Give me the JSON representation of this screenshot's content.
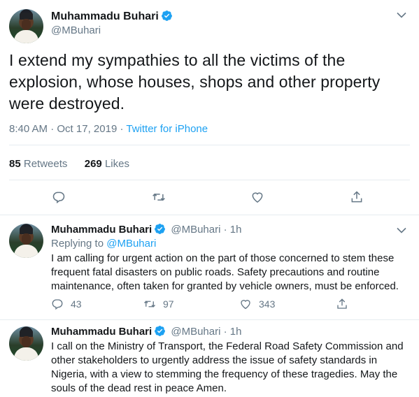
{
  "main_tweet": {
    "author_name": "Muhammadu Buhari",
    "author_handle": "@MBuhari",
    "text": "I extend my sympathies to all the victims of the explosion, whose houses, shops and other property were destroyed.",
    "time": "8:40 AM",
    "date": "Oct 17, 2019",
    "separator": "·",
    "client": "Twitter for iPhone",
    "retweets_count": "85",
    "retweets_label": "Retweets",
    "likes_count": "269",
    "likes_label": "Likes"
  },
  "replies": [
    {
      "author_name": "Muhammadu Buhari",
      "author_handle": "@MBuhari",
      "time_ago": "· 1h",
      "replying_label": "Replying to",
      "replying_to": "@MBuhari",
      "text": "I am calling for urgent action on the part of those concerned to stem these frequent fatal disasters on public roads. Safety precautions and routine maintenance, often taken for granted by vehicle owners, must be enforced.",
      "reply_count": "43",
      "retweet_count": "97",
      "like_count": "343"
    },
    {
      "author_name": "Muhammadu Buhari",
      "author_handle": "@MBuhari",
      "time_ago": "· 1h",
      "text": "I call on the Ministry of Transport, the Federal Road Safety Commission and other stakeholders to urgently address the issue of safety standards in Nigeria, with a view to stemming the frequency of these tragedies. May the souls of the dead rest in peace Amen."
    }
  ],
  "colors": {
    "accent": "#1da1f2",
    "secondary_text": "#657786",
    "primary_text": "#14171a",
    "divider": "#e6ecf0"
  },
  "icons": [
    "verified-badge-icon",
    "chevron-down-icon",
    "reply-icon",
    "retweet-icon",
    "like-icon",
    "share-icon"
  ]
}
